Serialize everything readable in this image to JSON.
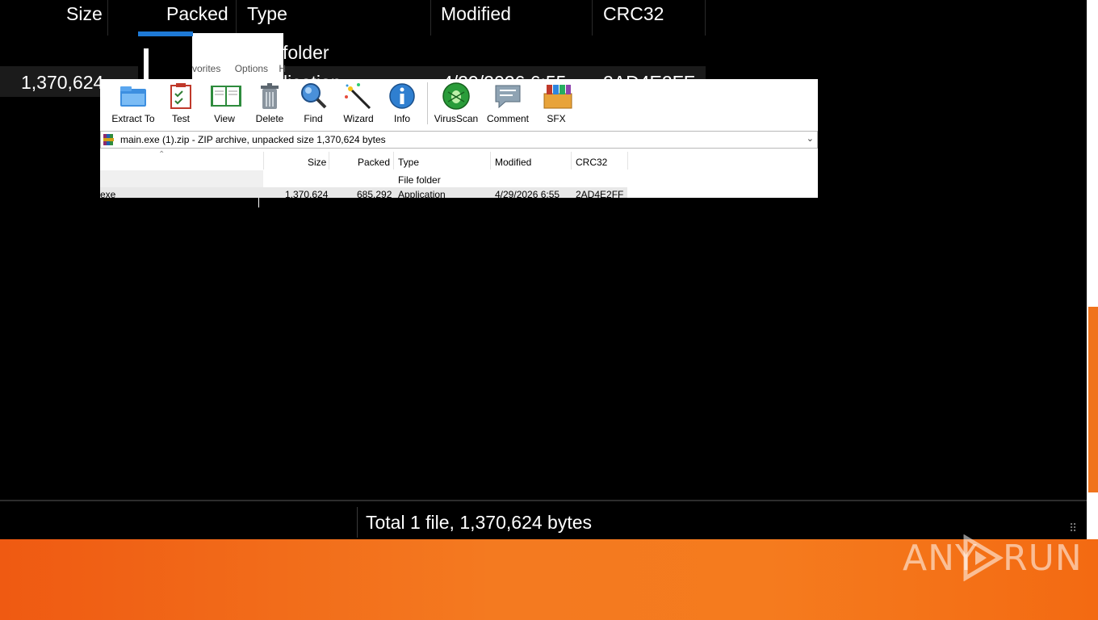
{
  "big_window": {
    "columns": [
      "Size",
      "Packed",
      "Type",
      "Modified",
      "CRC32"
    ],
    "folder_type_fragment": "folder",
    "row": {
      "size": "1,370,624",
      "packed": "685",
      "type": "lication",
      "modified": "4/29/2026 6:55",
      "crc": "2AD4E2FF"
    },
    "status": "Total 1 file, 1,370,624 bytes",
    "menu_fragment": [
      "vorites",
      "Options",
      "H"
    ]
  },
  "toolbar": {
    "buttons": [
      {
        "label": "Extract To",
        "icon": "extract-to-icon"
      },
      {
        "label": "Test",
        "icon": "test-icon"
      },
      {
        "label": "View",
        "icon": "view-icon"
      },
      {
        "label": "Delete",
        "icon": "delete-icon"
      },
      {
        "label": "Find",
        "icon": "find-icon"
      },
      {
        "label": "Wizard",
        "icon": "wizard-icon"
      },
      {
        "label": "Info",
        "icon": "info-icon"
      },
      {
        "label": "VirusScan",
        "icon": "virusscan-icon"
      },
      {
        "label": "Comment",
        "icon": "comment-icon"
      },
      {
        "label": "SFX",
        "icon": "sfx-icon"
      }
    ]
  },
  "path": {
    "text": "main.exe (1).zip - ZIP archive, unpacked size 1,370,624 bytes"
  },
  "list": {
    "headers": {
      "size": "Size",
      "packed": "Packed",
      "type": "Type",
      "modified": "Modified",
      "crc": "CRC32"
    },
    "rows": [
      {
        "name": "",
        "size": "",
        "packed": "",
        "type": "File folder",
        "modified": "",
        "crc": ""
      },
      {
        "name": "exe",
        "size": "1,370,624",
        "packed": "685,292",
        "type": "Application",
        "modified": "4/29/2026 6:55",
        "crc": "2AD4E2FF"
      }
    ]
  },
  "watermark": {
    "left": "ANY",
    "right": "RUN"
  }
}
